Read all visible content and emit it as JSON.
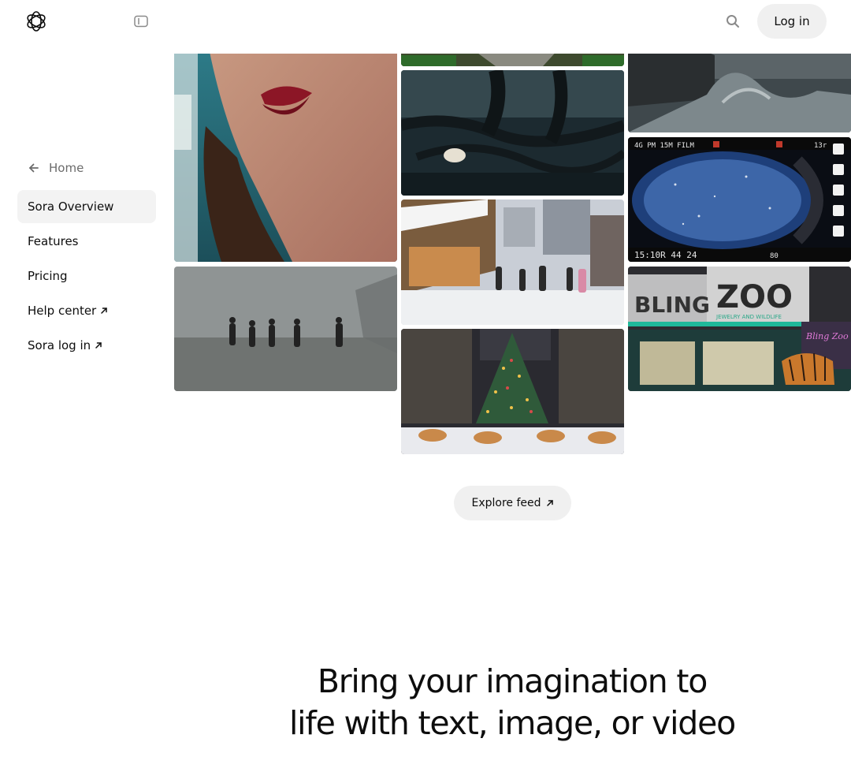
{
  "header": {
    "logo_icon": "openai-logo-icon",
    "sidebar_toggle_icon": "sidebar-toggle-icon",
    "search_icon": "search-icon",
    "login_label": "Log in"
  },
  "sidebar": {
    "home_label": "Home",
    "items": [
      {
        "label": "Sora Overview",
        "active": true,
        "external": false
      },
      {
        "label": "Features",
        "active": false,
        "external": false
      },
      {
        "label": "Pricing",
        "active": false,
        "external": false
      },
      {
        "label": "Help center",
        "active": false,
        "external": true
      },
      {
        "label": "Sora log in",
        "active": false,
        "external": true
      }
    ]
  },
  "gallery": {
    "tiles": [
      {
        "subject": "woman-red-lips"
      },
      {
        "subject": "figures-walking-in-fog"
      },
      {
        "subject": "forest-path-top"
      },
      {
        "subject": "tree-roots-water"
      },
      {
        "subject": "snowy-city-market"
      },
      {
        "subject": "christmas-tree-dogs"
      },
      {
        "subject": "ship-in-stormy-sea"
      },
      {
        "subject": "film-strip-space-scene",
        "overlay_text": [
          "4G PM 15M FILM",
          "15:10R 44 24",
          "13r",
          "80"
        ]
      },
      {
        "subject": "bling-zoo-storefront",
        "overlay_text": [
          "BLING",
          "ZOO",
          "JEWELRY AND WILDLIFE",
          "Bling Zoo"
        ]
      }
    ]
  },
  "explore": {
    "label": "Explore feed"
  },
  "hero": {
    "line1": "Bring your imagination to",
    "line2": "life with text, image, or video"
  },
  "colors": {
    "text": "#0d0d0d",
    "muted": "#6b6b6b",
    "button_bg": "#f0f0f0",
    "active_bg": "#f3f3f3"
  }
}
